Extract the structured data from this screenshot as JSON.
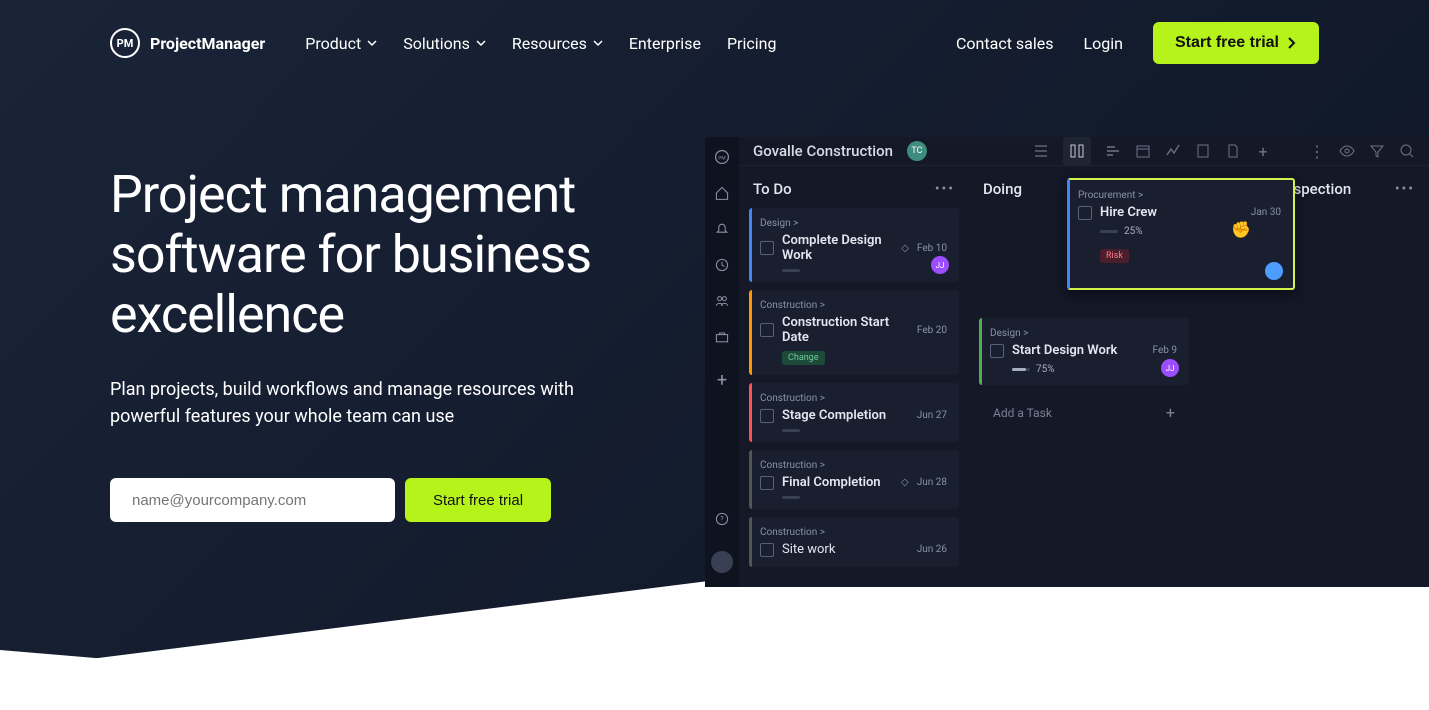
{
  "brand": "ProjectManager",
  "logo_initials": "PM",
  "nav": {
    "product": "Product",
    "solutions": "Solutions",
    "resources": "Resources",
    "enterprise": "Enterprise",
    "pricing": "Pricing",
    "contact": "Contact sales",
    "login": "Login",
    "trial": "Start free trial"
  },
  "hero": {
    "title": "Project management software for business excellence",
    "subtitle": "Plan projects, build workflows and manage resources with powerful features your whole team can use",
    "placeholder": "name@yourcompany.com",
    "cta": "Start free trial"
  },
  "app": {
    "project": "Govalle Construction",
    "team_initials": "TC",
    "add_task": "Add a Task",
    "columns": {
      "todo": "To Do",
      "doing": "Doing",
      "ready": "Ready for Inspection"
    },
    "cards": {
      "c1": {
        "cat": "Design >",
        "title": "Complete Design Work",
        "date": "Feb 10",
        "av": "JJ"
      },
      "c2": {
        "cat": "Construction >",
        "title": "Construction Start Date",
        "date": "Feb 20",
        "tag": "Change"
      },
      "c3": {
        "cat": "Construction >",
        "title": "Stage Completion",
        "date": "Jun 27"
      },
      "c4": {
        "cat": "Construction >",
        "title": "Final Completion",
        "date": "Jun 28"
      },
      "c5": {
        "cat": "Construction >",
        "title": "Site work",
        "date": "Jun 26"
      },
      "d1": {
        "cat": "Design >",
        "title": "Start Design Work",
        "date": "Feb 9",
        "pct": "75%",
        "av": "JJ"
      },
      "drag": {
        "cat": "Procurement >",
        "title": "Hire Crew",
        "date": "Jan 30",
        "pct": "25%",
        "tag": "Risk"
      }
    }
  }
}
